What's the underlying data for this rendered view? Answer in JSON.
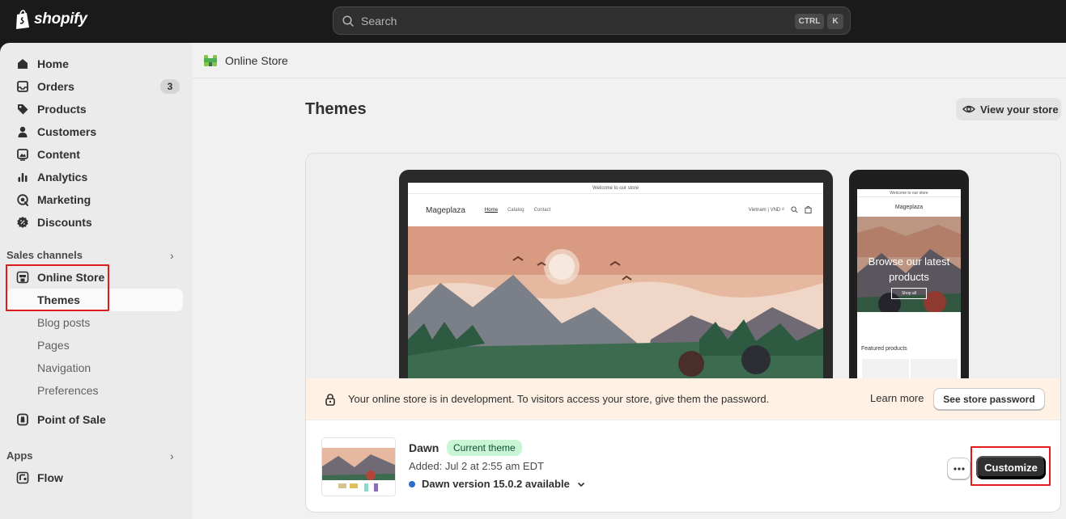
{
  "brand": {
    "name": "shopify"
  },
  "search": {
    "placeholder": "Search",
    "shortcut_ctrl": "CTRL",
    "shortcut_key": "K"
  },
  "sidebar": {
    "items": [
      {
        "label": "Home",
        "icon": "home-icon"
      },
      {
        "label": "Orders",
        "icon": "orders-icon",
        "badge": "3"
      },
      {
        "label": "Products",
        "icon": "tag-icon"
      },
      {
        "label": "Customers",
        "icon": "person-icon"
      },
      {
        "label": "Content",
        "icon": "content-icon"
      },
      {
        "label": "Analytics",
        "icon": "analytics-icon"
      },
      {
        "label": "Marketing",
        "icon": "marketing-icon"
      },
      {
        "label": "Discounts",
        "icon": "discount-icon"
      }
    ],
    "sales_channels": {
      "title": "Sales channels",
      "online_store": "Online Store",
      "sub_items": [
        "Themes",
        "Blog posts",
        "Pages",
        "Navigation",
        "Preferences"
      ],
      "point_of_sale": "Point of Sale"
    },
    "apps": {
      "title": "Apps",
      "flow": "Flow"
    }
  },
  "header": {
    "section": "Online Store"
  },
  "page": {
    "title": "Themes",
    "view_store": "View your store"
  },
  "preview": {
    "announcement": "Welcome to our store",
    "store_name": "Mageplaza",
    "nav": [
      "Home",
      "Catalog",
      "Contact"
    ],
    "region": "Vietnam | VND ₫",
    "mobile_hero_text": "Browse our latest products",
    "mobile_shop_btn": "Shop all",
    "featured": "Featured products"
  },
  "banner": {
    "text": "Your online store is in development. To visitors access your store, give them the password.",
    "learn_more": "Learn more",
    "see_password": "See store password"
  },
  "theme": {
    "name": "Dawn",
    "badge": "Current theme",
    "added": "Added: Jul 2 at 2:55 am EDT",
    "version": "Dawn version 15.0.2 available",
    "customize": "Customize"
  },
  "colors": {
    "topbar": "#1a1a1a",
    "sidebar": "#ebebeb",
    "badge_green": "#c9f5d4",
    "primary_button": "#303030",
    "banner": "#fff1e3",
    "highlight": "#e01b1b"
  }
}
